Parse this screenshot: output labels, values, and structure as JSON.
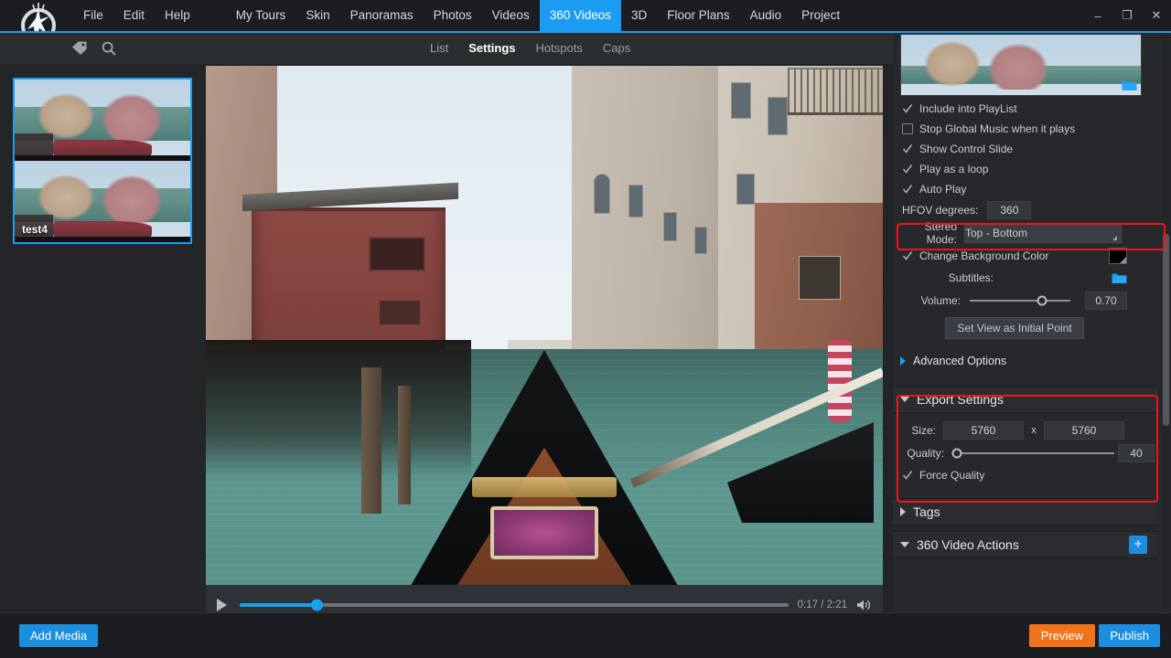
{
  "app": {
    "logo_icon": "pano2vr-logo-icon"
  },
  "titlebar": {
    "menus": [
      {
        "label": "File"
      },
      {
        "label": "Edit"
      },
      {
        "label": "Help"
      }
    ],
    "nav": [
      {
        "label": "My Tours",
        "active": false
      },
      {
        "label": "Skin",
        "active": false
      },
      {
        "label": "Panoramas",
        "active": false
      },
      {
        "label": "Photos",
        "active": false
      },
      {
        "label": "Videos",
        "active": false
      },
      {
        "label": "360 Videos",
        "active": true
      },
      {
        "label": "3D",
        "active": false
      },
      {
        "label": "Floor Plans",
        "active": false
      },
      {
        "label": "Audio",
        "active": false
      },
      {
        "label": "Project",
        "active": false
      }
    ],
    "window_controls": {
      "minimize": "–",
      "restore": "❐",
      "close": "✕"
    },
    "accent_color": "#1b9cf0"
  },
  "subbar": {
    "icons": [
      {
        "name": "tag-icon"
      },
      {
        "name": "search-icon"
      }
    ],
    "tabs": [
      {
        "label": "List",
        "active": false
      },
      {
        "label": "Settings",
        "active": true
      },
      {
        "label": "Hotspots",
        "active": false
      },
      {
        "label": "Caps",
        "active": false
      }
    ]
  },
  "left_panel": {
    "thumbnails": [
      {
        "label": "test4",
        "selected": true
      }
    ]
  },
  "player": {
    "play_label": "▶",
    "current_time": "0:17",
    "total_time": "2:21",
    "time_display": "0:17 / 2:21",
    "progress_percent": 14,
    "volume_icon": "speaker-icon"
  },
  "right_panel": {
    "checkboxes": [
      {
        "label": "Include into PlayList",
        "checked": true
      },
      {
        "label": "Stop Global Music when it plays",
        "checked": false
      },
      {
        "label": "Show Control Slide",
        "checked": true
      },
      {
        "label": "Play as a loop",
        "checked": true
      },
      {
        "label": "Auto Play",
        "checked": true
      }
    ],
    "hfov": {
      "label": "HFOV degrees:",
      "value": "360"
    },
    "stereo_mode": {
      "label": "Stereo Mode:",
      "value": "Top - Bottom",
      "highlighted": true
    },
    "change_background_color": {
      "label": "Change Background Color",
      "checked": true,
      "color": "#000000"
    },
    "subtitles": {
      "label": "Subtitles:",
      "icon": "folder-icon"
    },
    "volume": {
      "label": "Volume:",
      "value": "0.70",
      "position_percent": 72
    },
    "set_view_button": "Set View as Initial Point",
    "advanced_options": {
      "label": "Advanced Options",
      "expanded": false
    },
    "export_settings": {
      "title": "Export Settings",
      "expanded": true,
      "highlighted": true,
      "size_label": "Size:",
      "size_width": "5760",
      "size_separator": "x",
      "size_height": "5760",
      "quality_label": "Quality:",
      "quality_value": "40",
      "quality_position_percent": 2,
      "force_quality": {
        "label": "Force Quality",
        "checked": true
      }
    },
    "tags": {
      "title": "Tags",
      "expanded": false
    },
    "video_actions": {
      "title": "360 Video Actions",
      "expanded": true,
      "add_button": "+"
    },
    "highlight_color": "#f21414"
  },
  "bottombar": {
    "add_media": "Add Media",
    "preview": "Preview",
    "publish": "Publish"
  }
}
